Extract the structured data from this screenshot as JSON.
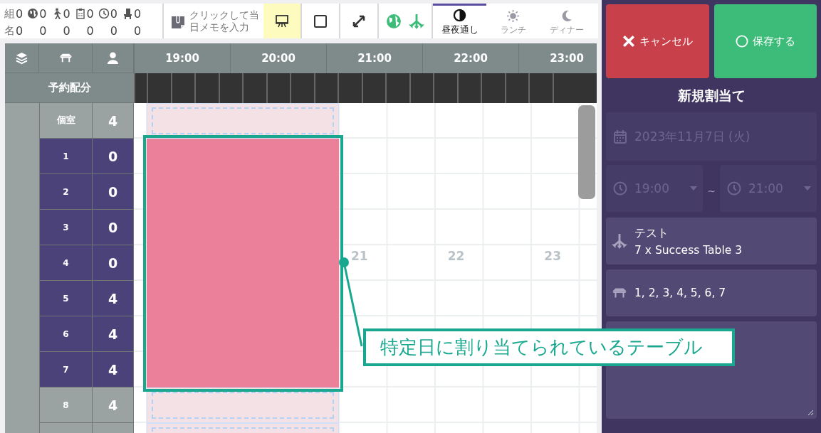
{
  "toolbar": {
    "stats": [
      {
        "kind": "label",
        "label": "組",
        "sub_label": "名",
        "count": "0",
        "sub_count": "0"
      },
      {
        "kind": "globe",
        "count": "0",
        "sub_count": "0"
      },
      {
        "kind": "walker",
        "count": "0",
        "sub_count": "0"
      },
      {
        "kind": "clipboard",
        "count": "0",
        "sub_count": "0"
      },
      {
        "kind": "clock",
        "count": "0",
        "sub_count": "0"
      },
      {
        "kind": "chair",
        "count": "0",
        "sub_count": "0"
      }
    ],
    "memo": {
      "label": "クリックして当日メモを入力"
    },
    "tools": [
      {
        "kind": "presentation",
        "selected": true
      },
      {
        "kind": "square",
        "selected": false
      },
      {
        "kind": "expand",
        "selected": false
      }
    ],
    "filters": [
      {
        "kind": "globe"
      },
      {
        "kind": "branch"
      }
    ],
    "tabs": [
      {
        "kind": "contrast",
        "label": "昼夜通し",
        "selected": true
      },
      {
        "kind": "sun",
        "label": "ランチ",
        "selected": false
      },
      {
        "kind": "moon",
        "label": "ディナー",
        "selected": false
      }
    ]
  },
  "grid": {
    "header_icons": [
      {
        "kind": "layers"
      },
      {
        "kind": "table"
      },
      {
        "kind": "person"
      }
    ],
    "hours": [
      "19:00",
      "20:00",
      "21:00",
      "22:00",
      "23:00"
    ],
    "allocation_label": "予約配分",
    "rows": [
      {
        "name": "個室",
        "count": "4",
        "selected": false
      },
      {
        "name": "1",
        "count": "0",
        "selected": true
      },
      {
        "name": "2",
        "count": "0",
        "selected": true
      },
      {
        "name": "3",
        "count": "0",
        "selected": true
      },
      {
        "name": "4",
        "count": "0",
        "selected": true
      },
      {
        "name": "5",
        "count": "4",
        "selected": true
      },
      {
        "name": "6",
        "count": "4",
        "selected": true
      },
      {
        "name": "7",
        "count": "4",
        "selected": true
      },
      {
        "name": "8",
        "count": "4",
        "selected": false
      }
    ],
    "faint_labels": [
      "21",
      "22",
      "23"
    ]
  },
  "annotation": {
    "text": "特定日に割り当てられているテーブル"
  },
  "panel": {
    "cancel_button": "キャンセル",
    "save_button": "保存する",
    "title": "新規割当て",
    "date": {
      "value": "2023年11月7日 (火)",
      "disabled": true
    },
    "start_time": {
      "value": "19:00",
      "disabled": true
    },
    "separator": "~",
    "end_time": {
      "value": "21:00",
      "disabled": true
    },
    "group": {
      "name": "テスト",
      "detail": "7 x Success Table 3"
    },
    "tables": "1, 2, 3, 4, 5, 6, 7"
  }
}
